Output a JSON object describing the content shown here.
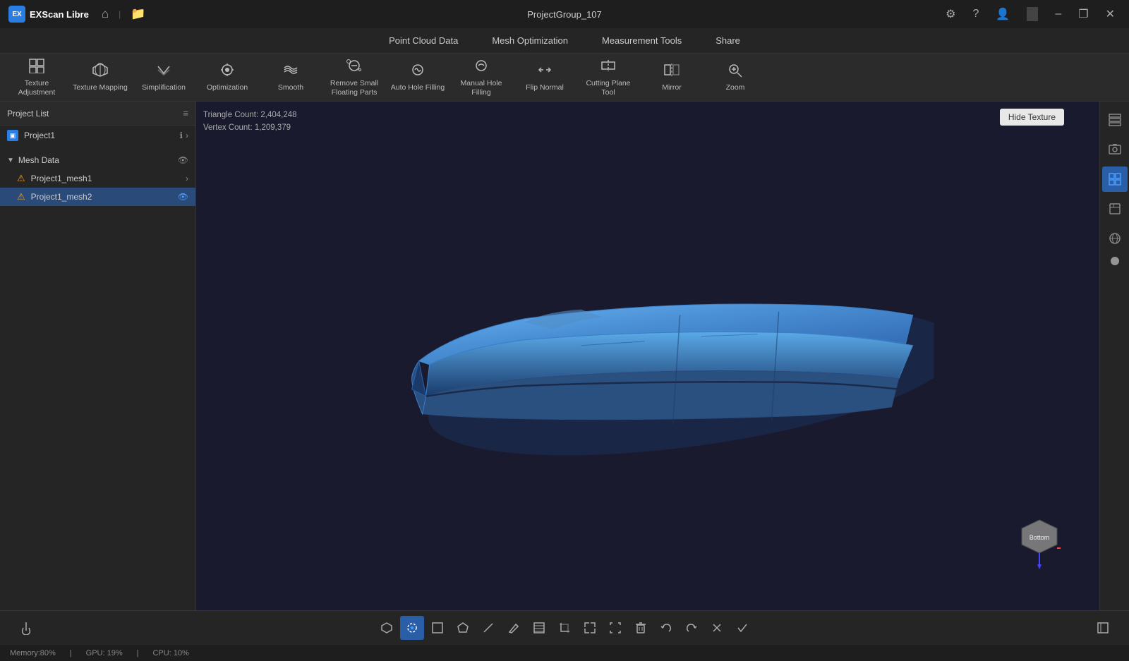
{
  "app": {
    "name": "EXScan Libre",
    "window_title": "ProjectGroup_107"
  },
  "titlebar": {
    "home_tooltip": "Home",
    "folder_tooltip": "Open folder",
    "minimize": "–",
    "maximize": "❐",
    "close": "✕"
  },
  "menubar": {
    "items": [
      {
        "label": "Point Cloud Data"
      },
      {
        "label": "Mesh Optimization"
      },
      {
        "label": "Measurement Tools"
      },
      {
        "label": "Share"
      }
    ]
  },
  "toolbar": {
    "tools": [
      {
        "id": "texture-adjustment",
        "label": "Texture Adjustment",
        "icon": "⊞"
      },
      {
        "id": "texture-mapping",
        "label": "Texture Mapping",
        "icon": "◫"
      },
      {
        "id": "simplification",
        "label": "Simplification",
        "icon": "⟺"
      },
      {
        "id": "optimization",
        "label": "Optimization",
        "icon": "◈"
      },
      {
        "id": "smooth",
        "label": "Smooth",
        "icon": "≋"
      },
      {
        "id": "remove-small",
        "label": "Remove Small Floating Parts",
        "icon": "◎"
      },
      {
        "id": "auto-hole",
        "label": "Auto Hole Filling",
        "icon": "⊗"
      },
      {
        "id": "manual-hole",
        "label": "Manual Hole Filling",
        "icon": "⊗"
      },
      {
        "id": "flip-normal",
        "label": "Flip Normal",
        "icon": "↔"
      },
      {
        "id": "cutting-plane",
        "label": "Cutting Plane Tool",
        "icon": "⊢"
      },
      {
        "id": "mirror",
        "label": "Mirror",
        "icon": "⊡"
      },
      {
        "id": "zoom",
        "label": "Zoom",
        "icon": "⊕"
      }
    ]
  },
  "sidebar": {
    "project_list_label": "Project List",
    "project_items": [
      {
        "name": "Project1"
      }
    ],
    "mesh_data_label": "Mesh Data",
    "mesh_items": [
      {
        "name": "Project1_mesh1",
        "active": false
      },
      {
        "name": "Project1_mesh2",
        "active": true
      }
    ]
  },
  "viewport": {
    "triangle_count_label": "Triangle Count: 2,404,248",
    "vertex_count_label": "Vertex Count: 1,209,379",
    "hide_texture_btn": "Hide Texture",
    "orient_label": "Bottom"
  },
  "right_panel": {
    "icons": [
      {
        "id": "layers",
        "symbol": "🗂",
        "active": false
      },
      {
        "id": "screenshot",
        "symbol": "📷",
        "active": false
      },
      {
        "id": "grid",
        "symbol": "▦",
        "active": true
      },
      {
        "id": "export",
        "symbol": "📤",
        "active": false
      },
      {
        "id": "globe",
        "symbol": "🌐",
        "active": false
      }
    ]
  },
  "bottom_toolbar": {
    "buttons": [
      {
        "id": "layers-btn",
        "symbol": "◫",
        "active": false
      },
      {
        "id": "lasso-btn",
        "symbol": "◯",
        "active": true,
        "type": "active"
      },
      {
        "id": "rect-sel",
        "symbol": "⬜",
        "active": false
      },
      {
        "id": "poly-sel",
        "symbol": "⬡",
        "active": false
      },
      {
        "id": "line-btn",
        "symbol": "╱",
        "active": false
      },
      {
        "id": "paint-btn",
        "symbol": "✎",
        "active": false
      },
      {
        "id": "rect2-btn",
        "symbol": "⬛",
        "active": false
      },
      {
        "id": "crop-btn",
        "symbol": "✂",
        "active": false
      },
      {
        "id": "expand-btn",
        "symbol": "⇱",
        "active": false
      },
      {
        "id": "fit-btn",
        "symbol": "⇲",
        "active": false
      },
      {
        "id": "delete-btn",
        "symbol": "🗑",
        "active": false
      },
      {
        "id": "undo-btn",
        "symbol": "↩",
        "active": false
      },
      {
        "id": "redo-btn",
        "symbol": "↪",
        "active": false
      },
      {
        "id": "cancel-btn",
        "symbol": "✕",
        "active": false
      },
      {
        "id": "confirm-btn",
        "symbol": "✓",
        "active": false
      }
    ]
  },
  "statusbar": {
    "memory": "Memory:80%",
    "gpu": "GPU: 19%",
    "cpu": "CPU: 10%"
  }
}
